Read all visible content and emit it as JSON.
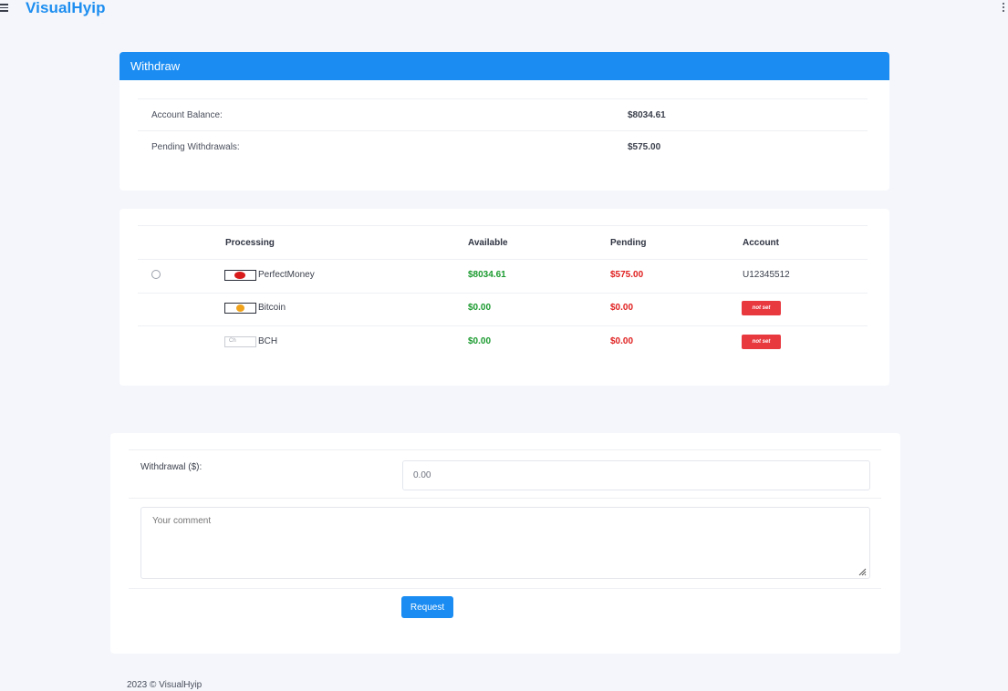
{
  "brand": "VisualHyip",
  "withdraw": {
    "title": "Withdraw",
    "balance_label": "Account Balance:",
    "balance_value": "$8034.61",
    "pending_label": "Pending Withdrawals:",
    "pending_value": "$575.00"
  },
  "table": {
    "headers": [
      "Processing",
      "Available",
      "Pending",
      "Account"
    ],
    "rows": [
      {
        "name": "PerfectMoney",
        "available": "$8034.61",
        "pending": "$575.00",
        "account": "U12345512"
      },
      {
        "name": "Bitcoin",
        "available": "$0.00",
        "pending": "$0.00",
        "account": "not set"
      },
      {
        "name": "BCH",
        "available": "$0.00",
        "pending": "$0.00",
        "account": "not set"
      }
    ],
    "bch_logo_text": "Ch"
  },
  "form": {
    "amount_label": "Withdrawal ($):",
    "amount_value": "0.00",
    "comment_placeholder": "Your comment",
    "submit_label": "Request"
  },
  "footer": "2023 © VisualHyip",
  "colors": {
    "accent": "#1a8cf2",
    "available": "#1a9a2e",
    "pending": "#e02020",
    "badge": "#e8393f"
  },
  "icons": {
    "menu": "menu-icon",
    "more": "kebab-icon",
    "perfectmoney": "perfectmoney-logo-icon",
    "bitcoin": "bitcoin-logo-icon",
    "bch": "bch-logo-icon",
    "resize": "resize-handle-icon"
  }
}
